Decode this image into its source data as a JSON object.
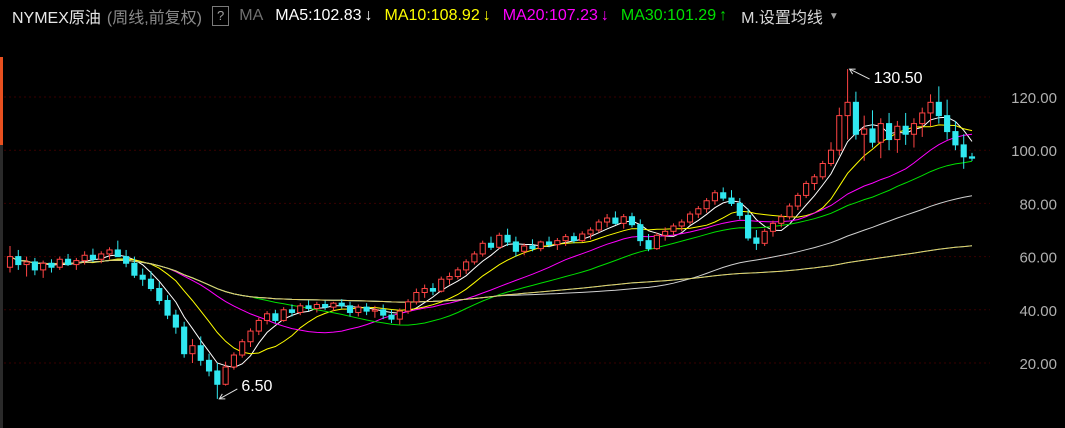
{
  "header": {
    "title": "NYMEX原油",
    "subtitle": "(周线,前复权)",
    "help_label": "?",
    "ma_label": "MA",
    "ma_items": [
      {
        "label": "MA5:102.83",
        "color": "#ffffff",
        "arrow": "↓"
      },
      {
        "label": "MA10:108.92",
        "color": "#ffff00",
        "arrow": "↓"
      },
      {
        "label": "MA20:107.23",
        "color": "#ff00ff",
        "arrow": "↓"
      },
      {
        "label": "MA30:101.29",
        "color": "#00e000",
        "arrow": "↑"
      }
    ],
    "settings_label": "M.设置均线",
    "settings_caret": "▼"
  },
  "chart_data": {
    "type": "candlestick",
    "timeframe": "weekly",
    "y_axis_ticks": [
      "120.00",
      "100.00",
      "80.00",
      "60.00",
      "40.00",
      "20.00"
    ],
    "ylim": [
      7,
      131
    ],
    "grid": true,
    "annotations": [
      {
        "text": "130.50",
        "value": 130.5,
        "kind": "high"
      },
      {
        "text": "6.50",
        "value": 6.5,
        "kind": "low"
      }
    ],
    "colors": {
      "up": "#ff4444",
      "down": "#30e8f0",
      "grid": "#3a0000",
      "axis_text": "#b0b0b0",
      "ma5": "#ffffff",
      "ma10": "#ffff00",
      "ma20": "#ff00ff",
      "ma30": "#00e000",
      "ma60": "#d0d0d0",
      "ma120": "#40b8ff",
      "ma250": "#e8d060"
    },
    "candles": [
      {
        "o": 56.0,
        "h": 64.0,
        "l": 54.0,
        "c": 60.0
      },
      {
        "o": 60.0,
        "h": 62.5,
        "l": 55.0,
        "c": 57.0
      },
      {
        "o": 57.0,
        "h": 60.0,
        "l": 52.5,
        "c": 58.0
      },
      {
        "o": 58.0,
        "h": 59.5,
        "l": 53.0,
        "c": 55.0
      },
      {
        "o": 55.0,
        "h": 58.5,
        "l": 52.0,
        "c": 57.5
      },
      {
        "o": 57.5,
        "h": 59.0,
        "l": 54.0,
        "c": 56.0
      },
      {
        "o": 56.0,
        "h": 60.0,
        "l": 55.0,
        "c": 59.0
      },
      {
        "o": 59.0,
        "h": 61.0,
        "l": 56.5,
        "c": 57.0
      },
      {
        "o": 57.0,
        "h": 59.5,
        "l": 55.0,
        "c": 58.5
      },
      {
        "o": 58.5,
        "h": 62.0,
        "l": 57.0,
        "c": 60.5
      },
      {
        "o": 60.5,
        "h": 63.0,
        "l": 58.0,
        "c": 59.0
      },
      {
        "o": 59.0,
        "h": 62.0,
        "l": 57.5,
        "c": 61.0
      },
      {
        "o": 61.0,
        "h": 63.5,
        "l": 59.0,
        "c": 62.5
      },
      {
        "o": 62.5,
        "h": 66.0,
        "l": 60.5,
        "c": 60.0
      },
      {
        "o": 60.0,
        "h": 62.5,
        "l": 56.0,
        "c": 57.5
      },
      {
        "o": 57.5,
        "h": 60.0,
        "l": 52.0,
        "c": 53.0
      },
      {
        "o": 53.0,
        "h": 55.5,
        "l": 49.0,
        "c": 51.5
      },
      {
        "o": 51.5,
        "h": 54.5,
        "l": 47.0,
        "c": 48.0
      },
      {
        "o": 48.0,
        "h": 50.5,
        "l": 42.0,
        "c": 43.5
      },
      {
        "o": 43.5,
        "h": 45.5,
        "l": 36.5,
        "c": 38.0
      },
      {
        "o": 38.0,
        "h": 40.0,
        "l": 31.0,
        "c": 33.5
      },
      {
        "o": 33.5,
        "h": 35.5,
        "l": 22.0,
        "c": 23.5
      },
      {
        "o": 23.5,
        "h": 29.0,
        "l": 20.0,
        "c": 26.5
      },
      {
        "o": 26.5,
        "h": 30.0,
        "l": 19.0,
        "c": 21.0
      },
      {
        "o": 21.0,
        "h": 23.5,
        "l": 15.0,
        "c": 17.0
      },
      {
        "o": 17.0,
        "h": 20.0,
        "l": 6.5,
        "c": 12.0
      },
      {
        "o": 12.0,
        "h": 20.5,
        "l": 11.5,
        "c": 18.5
      },
      {
        "o": 18.5,
        "h": 24.0,
        "l": 17.5,
        "c": 23.0
      },
      {
        "o": 23.0,
        "h": 29.0,
        "l": 22.0,
        "c": 28.0
      },
      {
        "o": 28.0,
        "h": 33.0,
        "l": 26.0,
        "c": 32.0
      },
      {
        "o": 32.0,
        "h": 37.0,
        "l": 30.5,
        "c": 36.0
      },
      {
        "o": 36.0,
        "h": 39.5,
        "l": 34.5,
        "c": 38.5
      },
      {
        "o": 38.5,
        "h": 40.0,
        "l": 35.0,
        "c": 36.0
      },
      {
        "o": 36.0,
        "h": 41.0,
        "l": 35.5,
        "c": 40.0
      },
      {
        "o": 40.0,
        "h": 42.0,
        "l": 37.5,
        "c": 39.0
      },
      {
        "o": 39.0,
        "h": 42.5,
        "l": 38.0,
        "c": 41.5
      },
      {
        "o": 41.5,
        "h": 43.5,
        "l": 39.5,
        "c": 40.5
      },
      {
        "o": 40.5,
        "h": 43.0,
        "l": 39.0,
        "c": 42.0
      },
      {
        "o": 42.0,
        "h": 43.5,
        "l": 40.0,
        "c": 41.0
      },
      {
        "o": 41.0,
        "h": 43.0,
        "l": 39.5,
        "c": 42.5
      },
      {
        "o": 42.5,
        "h": 44.0,
        "l": 40.5,
        "c": 41.5
      },
      {
        "o": 41.5,
        "h": 43.0,
        "l": 37.5,
        "c": 39.0
      },
      {
        "o": 39.0,
        "h": 42.0,
        "l": 37.5,
        "c": 41.0
      },
      {
        "o": 41.0,
        "h": 42.5,
        "l": 38.0,
        "c": 39.5
      },
      {
        "o": 39.5,
        "h": 41.5,
        "l": 37.0,
        "c": 40.0
      },
      {
        "o": 40.0,
        "h": 42.0,
        "l": 36.5,
        "c": 38.0
      },
      {
        "o": 38.0,
        "h": 40.0,
        "l": 35.0,
        "c": 36.5
      },
      {
        "o": 36.5,
        "h": 40.5,
        "l": 34.5,
        "c": 39.5
      },
      {
        "o": 39.5,
        "h": 44.0,
        "l": 38.5,
        "c": 43.0
      },
      {
        "o": 43.0,
        "h": 48.0,
        "l": 42.0,
        "c": 46.5
      },
      {
        "o": 46.5,
        "h": 49.5,
        "l": 44.5,
        "c": 48.0
      },
      {
        "o": 48.0,
        "h": 50.0,
        "l": 45.5,
        "c": 47.0
      },
      {
        "o": 47.0,
        "h": 52.5,
        "l": 46.5,
        "c": 51.5
      },
      {
        "o": 51.5,
        "h": 54.0,
        "l": 49.5,
        "c": 52.5
      },
      {
        "o": 52.5,
        "h": 56.0,
        "l": 51.5,
        "c": 55.0
      },
      {
        "o": 55.0,
        "h": 59.0,
        "l": 53.5,
        "c": 58.0
      },
      {
        "o": 58.0,
        "h": 62.0,
        "l": 57.0,
        "c": 61.0
      },
      {
        "o": 61.0,
        "h": 66.0,
        "l": 60.0,
        "c": 65.0
      },
      {
        "o": 65.0,
        "h": 67.5,
        "l": 62.5,
        "c": 63.5
      },
      {
        "o": 63.5,
        "h": 69.0,
        "l": 63.0,
        "c": 68.0
      },
      {
        "o": 68.0,
        "h": 70.5,
        "l": 64.0,
        "c": 65.5
      },
      {
        "o": 65.5,
        "h": 67.5,
        "l": 60.0,
        "c": 62.0
      },
      {
        "o": 62.0,
        "h": 65.0,
        "l": 60.5,
        "c": 64.0
      },
      {
        "o": 64.0,
        "h": 66.5,
        "l": 62.0,
        "c": 63.0
      },
      {
        "o": 63.0,
        "h": 66.0,
        "l": 62.0,
        "c": 65.5
      },
      {
        "o": 65.5,
        "h": 67.5,
        "l": 63.5,
        "c": 64.5
      },
      {
        "o": 64.5,
        "h": 67.0,
        "l": 62.5,
        "c": 66.0
      },
      {
        "o": 66.0,
        "h": 68.5,
        "l": 64.0,
        "c": 67.5
      },
      {
        "o": 67.5,
        "h": 69.0,
        "l": 65.0,
        "c": 66.0
      },
      {
        "o": 66.0,
        "h": 69.5,
        "l": 65.5,
        "c": 68.5
      },
      {
        "o": 68.5,
        "h": 71.0,
        "l": 66.5,
        "c": 70.0
      },
      {
        "o": 70.0,
        "h": 74.0,
        "l": 69.0,
        "c": 73.0
      },
      {
        "o": 73.0,
        "h": 76.0,
        "l": 71.0,
        "c": 74.5
      },
      {
        "o": 74.5,
        "h": 77.0,
        "l": 72.0,
        "c": 72.5
      },
      {
        "o": 72.5,
        "h": 76.0,
        "l": 70.5,
        "c": 75.0
      },
      {
        "o": 75.0,
        "h": 76.5,
        "l": 71.0,
        "c": 72.0
      },
      {
        "o": 72.0,
        "h": 74.0,
        "l": 64.0,
        "c": 66.0
      },
      {
        "o": 66.0,
        "h": 68.5,
        "l": 62.0,
        "c": 63.0
      },
      {
        "o": 63.0,
        "h": 69.0,
        "l": 62.5,
        "c": 68.0
      },
      {
        "o": 68.0,
        "h": 71.0,
        "l": 66.0,
        "c": 69.5
      },
      {
        "o": 69.5,
        "h": 72.5,
        "l": 68.0,
        "c": 71.5
      },
      {
        "o": 71.5,
        "h": 74.0,
        "l": 69.5,
        "c": 73.0
      },
      {
        "o": 73.0,
        "h": 77.0,
        "l": 72.0,
        "c": 76.0
      },
      {
        "o": 76.0,
        "h": 79.0,
        "l": 74.5,
        "c": 78.0
      },
      {
        "o": 78.0,
        "h": 82.0,
        "l": 76.5,
        "c": 81.0
      },
      {
        "o": 81.0,
        "h": 85.0,
        "l": 79.5,
        "c": 84.0
      },
      {
        "o": 84.0,
        "h": 86.0,
        "l": 81.0,
        "c": 82.0
      },
      {
        "o": 82.0,
        "h": 85.0,
        "l": 79.0,
        "c": 80.0
      },
      {
        "o": 80.0,
        "h": 82.0,
        "l": 74.0,
        "c": 75.5
      },
      {
        "o": 75.5,
        "h": 78.0,
        "l": 66.0,
        "c": 67.0
      },
      {
        "o": 67.0,
        "h": 70.0,
        "l": 62.5,
        "c": 65.0
      },
      {
        "o": 65.0,
        "h": 70.5,
        "l": 64.0,
        "c": 69.5
      },
      {
        "o": 69.5,
        "h": 73.5,
        "l": 67.5,
        "c": 72.5
      },
      {
        "o": 72.5,
        "h": 76.0,
        "l": 71.0,
        "c": 75.0
      },
      {
        "o": 75.0,
        "h": 80.0,
        "l": 74.0,
        "c": 79.0
      },
      {
        "o": 79.0,
        "h": 84.0,
        "l": 77.5,
        "c": 83.0
      },
      {
        "o": 83.0,
        "h": 88.5,
        "l": 82.0,
        "c": 87.5
      },
      {
        "o": 87.5,
        "h": 91.0,
        "l": 85.0,
        "c": 90.0
      },
      {
        "o": 90.0,
        "h": 96.0,
        "l": 89.0,
        "c": 95.0
      },
      {
        "o": 95.0,
        "h": 103.0,
        "l": 94.0,
        "c": 100.0
      },
      {
        "o": 100.0,
        "h": 116.0,
        "l": 98.0,
        "c": 113.0
      },
      {
        "o": 113.0,
        "h": 130.5,
        "l": 104.0,
        "c": 118.0
      },
      {
        "o": 118.0,
        "h": 122.0,
        "l": 104.0,
        "c": 106.0
      },
      {
        "o": 106.0,
        "h": 113.0,
        "l": 96.0,
        "c": 108.0
      },
      {
        "o": 108.0,
        "h": 115.0,
        "l": 101.0,
        "c": 103.0
      },
      {
        "o": 103.0,
        "h": 112.0,
        "l": 97.0,
        "c": 110.0
      },
      {
        "o": 110.0,
        "h": 114.0,
        "l": 100.0,
        "c": 104.0
      },
      {
        "o": 104.0,
        "h": 111.0,
        "l": 99.0,
        "c": 109.0
      },
      {
        "o": 109.0,
        "h": 114.0,
        "l": 102.0,
        "c": 106.0
      },
      {
        "o": 106.0,
        "h": 112.0,
        "l": 101.0,
        "c": 110.0
      },
      {
        "o": 110.0,
        "h": 116.0,
        "l": 105.0,
        "c": 114.0
      },
      {
        "o": 114.0,
        "h": 121.0,
        "l": 109.0,
        "c": 118.0
      },
      {
        "o": 118.0,
        "h": 124.0,
        "l": 110.0,
        "c": 113.0
      },
      {
        "o": 113.0,
        "h": 119.0,
        "l": 104.0,
        "c": 107.0
      },
      {
        "o": 107.0,
        "h": 111.0,
        "l": 100.0,
        "c": 102.0
      },
      {
        "o": 102.0,
        "h": 106.0,
        "l": 93.0,
        "c": 97.5
      },
      {
        "o": 97.5,
        "h": 99.0,
        "l": 96.0,
        "c": 97.0
      }
    ],
    "ma_lines": [
      {
        "name": "MA5",
        "period": 5,
        "color": "#ffffff"
      },
      {
        "name": "MA10",
        "period": 10,
        "color": "#ffff00"
      },
      {
        "name": "MA20",
        "period": 20,
        "color": "#ff00ff"
      },
      {
        "name": "MA30",
        "period": 30,
        "color": "#00e000"
      },
      {
        "name": "MA60",
        "period": 60,
        "color": "#d0d0d0"
      },
      {
        "name": "MA120",
        "period": 120,
        "color": "#40b8ff"
      },
      {
        "name": "MA250",
        "period": 250,
        "color": "#e8d060"
      }
    ]
  }
}
